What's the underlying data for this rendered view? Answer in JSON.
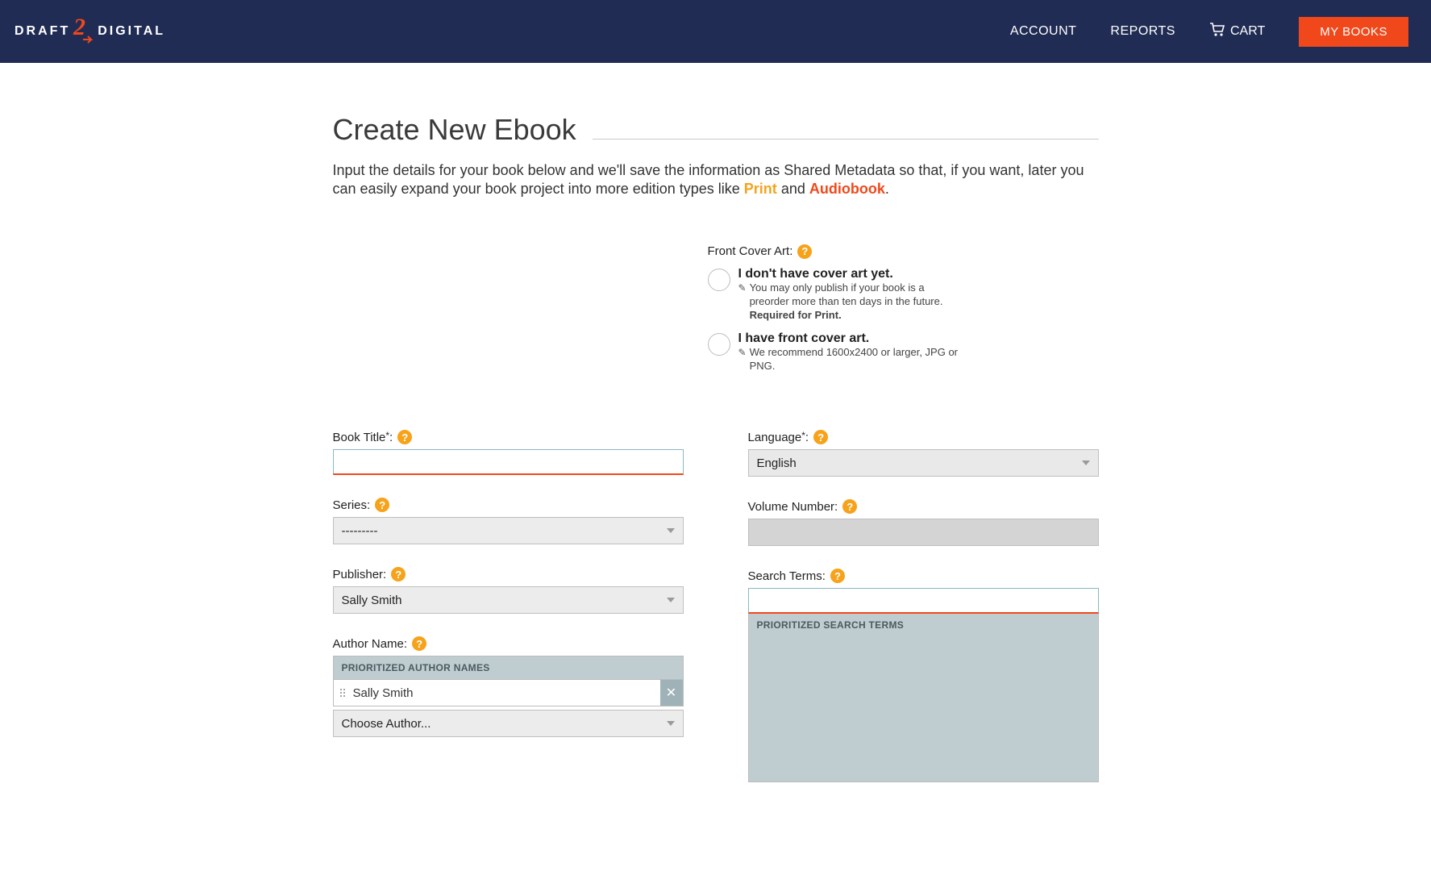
{
  "header": {
    "logo_left": "DRAFT",
    "logo_right": "DIGITAL",
    "nav": {
      "account": "ACCOUNT",
      "reports": "REPORTS",
      "cart": "CART",
      "mybooks": "MY BOOKS"
    }
  },
  "page": {
    "title": "Create New Ebook",
    "intro_before": "Input the details for your book below and we'll save the information as Shared Metadata so that, if you want, later you can easily expand your book project into more edition types like ",
    "intro_print": "Print",
    "intro_and": " and ",
    "intro_audio": "Audiobook",
    "intro_after": "."
  },
  "cover": {
    "label": "Front Cover Art:",
    "opt1_title": "I don't have cover art yet.",
    "opt1_sub": "You may only publish if your book is a preorder more than ten days in the future. ",
    "opt1_req": "Required for Print.",
    "opt2_title": "I have front cover art.",
    "opt2_sub": "We recommend 1600x2400 or larger, JPG or PNG."
  },
  "form": {
    "book_title_label": "Book Title",
    "series_label": "Series:",
    "series_value": "---------",
    "publisher_label": "Publisher:",
    "publisher_value": "Sally Smith",
    "author_label": "Author Name:",
    "author_panel_header": "PRIORITIZED AUTHOR NAMES",
    "author_item": "Sally Smith",
    "author_choose": "Choose Author...",
    "language_label": "Language",
    "language_value": "English",
    "volume_label": "Volume Number:",
    "search_label": "Search Terms:",
    "search_panel_header": "PRIORITIZED SEARCH TERMS"
  }
}
